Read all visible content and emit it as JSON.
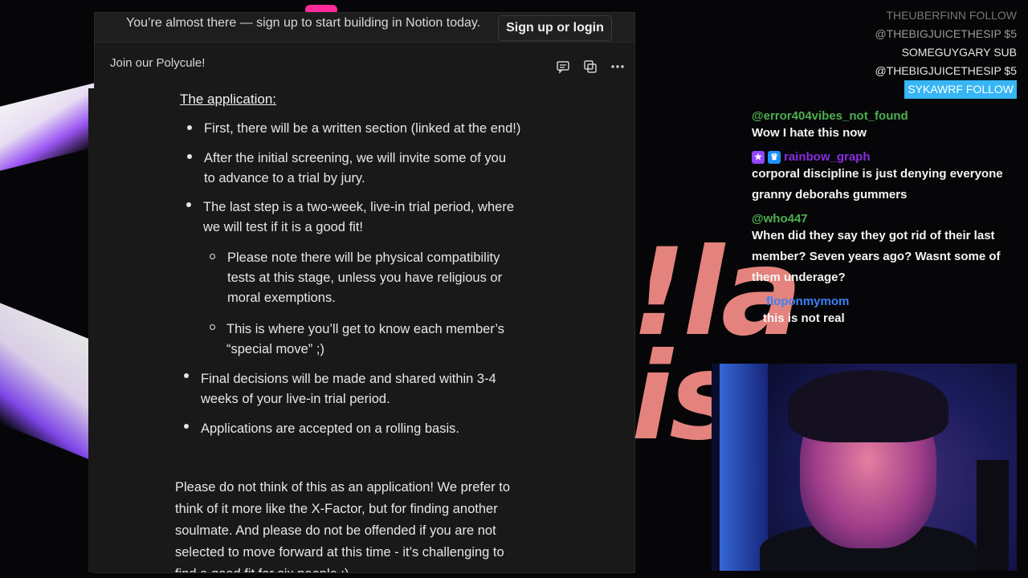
{
  "banner": {
    "text": "You’re almost there — sign up to start building in Notion today.",
    "button": "Sign up or login"
  },
  "window": {
    "title": "Join our Polycule!",
    "icons": [
      "comment-icon",
      "duplicate-icon",
      "more-icon"
    ]
  },
  "doc": {
    "heading": "The application:",
    "items": [
      "First, there will be a written section (linked at the end!)",
      "After the initial screening, we will invite some of you",
      "to advance to a trial by jury.",
      "The last step is a two-week, live-in trial period, where",
      "we will test if it is a good fit!",
      "Please note there will be physical compatibility",
      "tests at this stage, unless you have religious or",
      "moral exemptions.",
      "This is where you’ll get to know each member’s",
      "“special move” ;)",
      "Final decisions will be made and shared within 3-4",
      "weeks of your live-in trial period.",
      "Applications are accepted on a rolling basis."
    ],
    "paragraph": [
      "Please do not think of this as an application! We prefer to",
      "think of it more like the X-Factor, but for finding another",
      "soulmate. And please do not be offended if you are not",
      "selected to move forward at this time - it’s challenging to",
      "find a good fit for six people :)"
    ]
  },
  "overlay": {
    "line1": "!la",
    "line2": "is"
  },
  "alerts": [
    {
      "name": "THEUBERFINN",
      "action": "FOLLOW"
    },
    {
      "name": "@THEBIGJUICETHESIP",
      "action": "$5"
    },
    {
      "name": "SOMEGUYGARY",
      "action": "SUB"
    },
    {
      "name": "@THEBIGJUICETHESIP",
      "action": "$5"
    },
    {
      "name": "SYKAWRF",
      "action": "FOLLOW"
    }
  ],
  "chat": [
    {
      "user": "@error404vibes_not_found",
      "color": "#4caf50",
      "message": "Wow I hate this now"
    },
    {
      "user": "rainbow_graph",
      "color": "#8a2be2",
      "message": "corporal discipline is just denying everyone granny deborahs gummers"
    },
    {
      "user": "@who447",
      "color": "#4caf50",
      "message": "When did they say they got rid of their last member? Seven years ago? Wasnt some of them underage?"
    },
    {
      "user": "floponmymom",
      "color": "#3b82f6",
      "message": "this is not real"
    }
  ]
}
